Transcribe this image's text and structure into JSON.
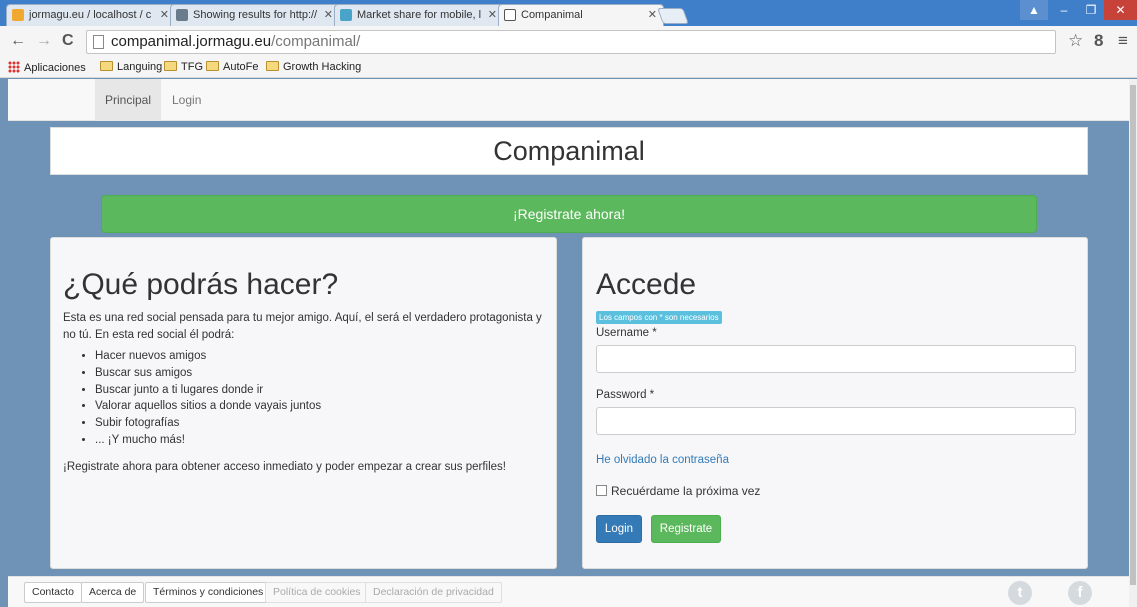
{
  "browser": {
    "tabs": [
      {
        "label": "jormagu.eu / localhost / c",
        "active": false
      },
      {
        "label": "Showing results for http://",
        "active": false
      },
      {
        "label": "Market share for mobile, l",
        "active": false
      },
      {
        "label": "Companimal",
        "active": true
      }
    ],
    "address": {
      "host": "companimal.jormagu.eu",
      "path": "/companimal/"
    },
    "bookmarks": [
      "Aplicaciones",
      "Languing",
      "TFG",
      "AutoFe",
      "Growth Hacking"
    ]
  },
  "topnav": {
    "items": [
      "Principal",
      "Login"
    ],
    "active": "Principal"
  },
  "header": {
    "title": "Companimal"
  },
  "register_banner": "¡Registrate ahora!",
  "about": {
    "heading": "¿Qué podrás hacer?",
    "intro": "Esta es una red social pensada para tu mejor amigo. Aquí, el será el verdadero protagonista y no tú. En esta red social él podrá:",
    "features": [
      "Hacer nuevos amigos",
      "Buscar sus amigos",
      "Buscar junto a ti lugares donde ir",
      "Valorar aquellos sitios a donde vayais juntos",
      "Subir fotografías",
      "... ¡Y mucho más!"
    ],
    "cta": "¡Registrate ahora para obtener acceso inmediato y poder empezar a crear sus perfiles!"
  },
  "login": {
    "heading": "Accede",
    "required_note": "Los campos con * son necesarios",
    "username_label": "Username *",
    "username_value": "",
    "password_label": "Password *",
    "password_value": "",
    "forgot_link": "He olvidado la contraseña",
    "remember_label": "Recuérdame la próxima vez",
    "login_button": "Login",
    "register_button": "Registrate"
  },
  "footer": {
    "buttons": [
      {
        "label": "Contacto",
        "enabled": true
      },
      {
        "label": "Acerca de",
        "enabled": true
      },
      {
        "label": "Términos y condiciones",
        "enabled": true
      },
      {
        "label": "Política de cookies",
        "enabled": false
      },
      {
        "label": "Declaración de privacidad",
        "enabled": false
      }
    ],
    "social_icons": [
      "twitter-icon",
      "facebook-icon"
    ]
  },
  "colors": {
    "page_bg": "#6f93b6",
    "success": "#5cb85c",
    "primary": "#337ab7",
    "info": "#5bc0de"
  }
}
